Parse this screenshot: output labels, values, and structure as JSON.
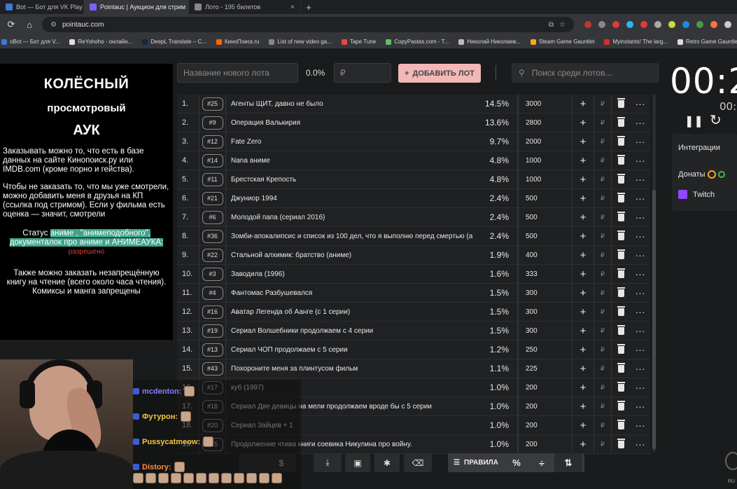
{
  "browser": {
    "tabs": [
      {
        "title": "Bot — Бот для VK Play",
        "color": "#3a7bd5",
        "active": false
      },
      {
        "title": "Pointauc | Аукцион для стрим",
        "color": "#7b61ff",
        "active": true
      },
      {
        "title": "Лото - 195 билетов",
        "color": "#888888",
        "active": false
      }
    ],
    "url": "pointauc.com",
    "bookmarks": [
      {
        "label": "oBot — Бот для V...",
        "color": "#3a7bd5"
      },
      {
        "label": "ReYohoho - онлайн...",
        "color": "#e0e0e0"
      },
      {
        "label": "DeepL Translate – С...",
        "color": "#0f2b46"
      },
      {
        "label": "КиноПоиск.ru",
        "color": "#ff6600"
      },
      {
        "label": "List of new video ga...",
        "color": "#888888"
      },
      {
        "label": "Tape Tune",
        "color": "#e44"
      },
      {
        "label": "CopyPastas.com - T...",
        "color": "#66bb6a"
      },
      {
        "label": "Николай Николаев...",
        "color": "#bbbbbb"
      },
      {
        "label": "Steam Game Gauntlet",
        "color": "#f5a623"
      },
      {
        "label": "Myinstants! The larg...",
        "color": "#d32f2f"
      },
      {
        "label": "Retro Game Gauntlet",
        "color": "#dddddd"
      }
    ]
  },
  "left_panel": {
    "title1": "КОЛЁСНЫЙ",
    "title2": "просмотровый",
    "title3": "АУК",
    "para1": "Заказывать можно то, что есть в базе данных на сайте Кинопоиск.ру или IMDB.com (кроме порно и гейства).",
    "para2": "Чтобы не заказать то, что мы уже смотрели, можно добавить меня в друзья на КП (ссылка под стримом). Если у фильма есть оценка — значит, смотрели",
    "status_prefix": "Статус",
    "status_hl1": "аниме , \"анимеподобного\",",
    "status_hl2": "документалок про аниме и АНИМЕАУКА:",
    "status_allowed": "разрешено",
    "para4": "Также можно заказать незапрещённую книгу на чтение (всего около часа чтения). Комиксы и манга запрещены"
  },
  "form": {
    "lot_placeholder": "Название нового лота",
    "percent": "0.0%",
    "rub_placeholder": "₽",
    "add_label": "ДОБАВИТЬ ЛОТ",
    "search_placeholder": "Поиск среди лотов..."
  },
  "lots": [
    {
      "n": "1.",
      "id": "#25",
      "name": "Агенты ЩИТ, давно не было",
      "pct": "14.5%",
      "amount": "3000"
    },
    {
      "n": "2.",
      "id": "#9",
      "name": "Операция Валькирия",
      "pct": "13.6%",
      "amount": "2800"
    },
    {
      "n": "3.",
      "id": "#12",
      "name": "Fate Zero",
      "pct": "9.7%",
      "amount": "2000"
    },
    {
      "n": "4.",
      "id": "#14",
      "name": "Nana аниме",
      "pct": "4.8%",
      "amount": "1000"
    },
    {
      "n": "5.",
      "id": "#11",
      "name": "Брестская Крепость",
      "pct": "4.8%",
      "amount": "1000"
    },
    {
      "n": "6.",
      "id": "#21",
      "name": "Джуниор 1994",
      "pct": "2.4%",
      "amount": "500"
    },
    {
      "n": "7.",
      "id": "#6",
      "name": "Молодой папа (сериал 2016)",
      "pct": "2.4%",
      "amount": "500"
    },
    {
      "n": "8.",
      "id": "#36",
      "name": "Зомби-апокалипсис и список из 100 дел, что я выполню перед смертью (а",
      "pct": "2.4%",
      "amount": "500"
    },
    {
      "n": "9.",
      "id": "#22",
      "name": "Стальной алхимик: братство (аниме)",
      "pct": "1.9%",
      "amount": "400"
    },
    {
      "n": "10.",
      "id": "#3",
      "name": "Заводила (1996)",
      "pct": "1.6%",
      "amount": "333"
    },
    {
      "n": "11.",
      "id": "#4",
      "name": "Фантомас Разбушевался",
      "pct": "1.5%",
      "amount": "300"
    },
    {
      "n": "12.",
      "id": "#16",
      "name": "Аватар Легенда об Аанге (с 1 серии)",
      "pct": "1.5%",
      "amount": "300"
    },
    {
      "n": "13.",
      "id": "#19",
      "name": "Сериал Волшебники продолжаем с 4 серии",
      "pct": "1.5%",
      "amount": "300"
    },
    {
      "n": "14.",
      "id": "#13",
      "name": "Сериал ЧОП продолжаем с 5 серии",
      "pct": "1.2%",
      "amount": "250"
    },
    {
      "n": "15.",
      "id": "#43",
      "name": "Похороните меня за плинтусом фильм",
      "pct": "1.1%",
      "amount": "225"
    },
    {
      "n": "16.",
      "id": "#17",
      "name": "куб (1997)",
      "pct": "1.0%",
      "amount": "200"
    },
    {
      "n": "17.",
      "id": "#18",
      "name": "Сериал Две девицы на мели продолжаем вроде бы с 5 серии",
      "pct": "1.0%",
      "amount": "200"
    },
    {
      "n": "18.",
      "id": "#20",
      "name": "Сериал Зайцев + 1",
      "pct": "1.0%",
      "amount": "200"
    },
    {
      "n": "19.",
      "id": "#15",
      "name": "Продолжение чтива книги соевика Никулина про войну.",
      "pct": "1.0%",
      "amount": "200"
    }
  ],
  "row_plus": "+",
  "row_rub": "₽",
  "row_more": "···",
  "toolbar": {
    "dollar": "$",
    "rules_label": "ПРАВИЛА",
    "percent_icon": "%"
  },
  "timer": {
    "main": "00:2",
    "sub": "00:"
  },
  "integrations": {
    "title": "Интеграции",
    "donations": "Донаты",
    "twitch": "Twitch"
  },
  "chat": [
    {
      "user": "mcdenton:",
      "color": "#8a7bff"
    },
    {
      "user": "Футурон:",
      "color": "#f5c542"
    },
    {
      "user": "Pussycatmeow:",
      "color": "#f5c542"
    },
    {
      "user": "Distory:",
      "color": "#ff8c3a"
    }
  ],
  "lang": "RU"
}
